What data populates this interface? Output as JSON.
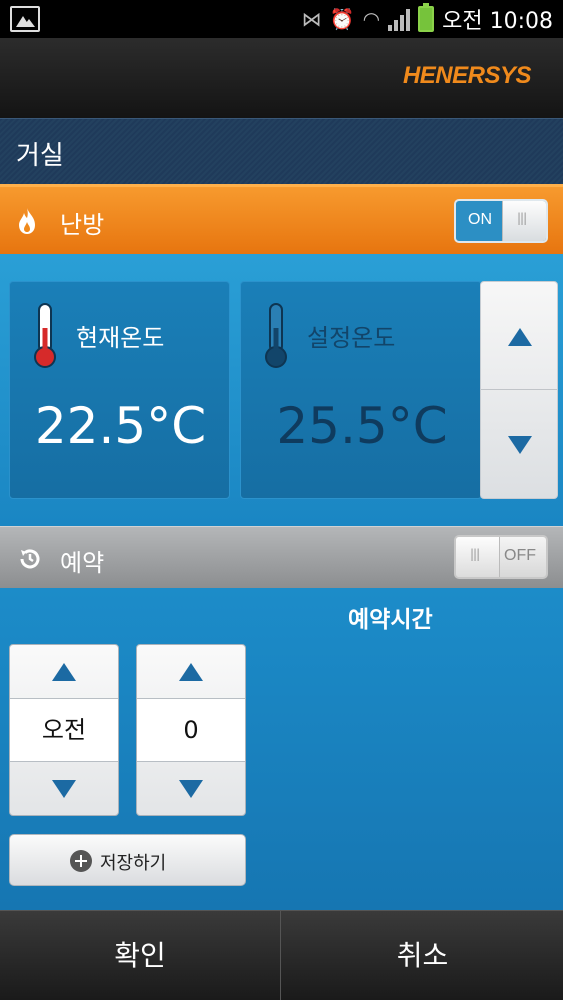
{
  "status_bar": {
    "time": "오전 10:08",
    "icons": [
      "picture-icon",
      "nfc-icon",
      "alarm-icon",
      "wifi-icon",
      "signal-icon",
      "battery-icon"
    ]
  },
  "header": {
    "brand": "HENERSYS"
  },
  "room": {
    "title": "거실"
  },
  "heating": {
    "label": "난방",
    "toggle_label": "ON",
    "enabled": true
  },
  "current_temp": {
    "label": "현재온도",
    "value": "22.5°C"
  },
  "set_temp": {
    "label": "설정온도",
    "value": "25.5°C"
  },
  "reservation": {
    "label": "예약",
    "toggle_label": "OFF",
    "enabled": false,
    "time_label": "예약시간",
    "ampm_value": "오전",
    "hour_value": "0",
    "save_label": "저장하기"
  },
  "bottom": {
    "confirm_label": "확인",
    "cancel_label": "취소"
  },
  "colors": {
    "accent_orange": "#F08A1C",
    "accent_blue": "#2A9FD6",
    "arrow_blue": "#1C6AA3"
  }
}
